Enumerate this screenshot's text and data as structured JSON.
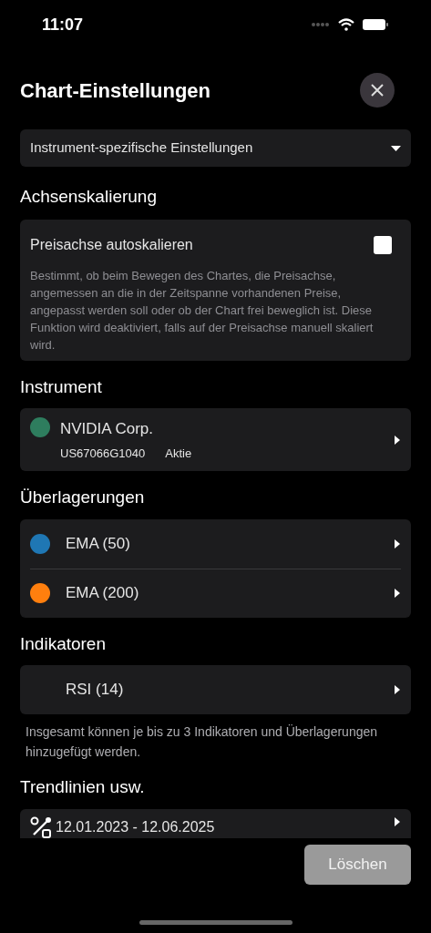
{
  "status_bar": {
    "time": "11:07"
  },
  "header": {
    "title": "Chart-Einstellungen"
  },
  "scope_dropdown": {
    "value": "Instrument-spezifische Einstellungen"
  },
  "axis_scaling": {
    "heading": "Achsenskalierung",
    "option": {
      "label": "Preisachse autoskalieren",
      "checked": false,
      "description": "Bestimmt, ob beim Bewegen des Chartes, die Preisachse, angemessen an die in der Zeitspanne vorhandenen Preise, angepasst werden soll oder ob der Chart frei beweglich ist. Diese Funktion wird deaktiviert, falls auf der Preisachse manuell skaliert wird."
    }
  },
  "instrument": {
    "heading": "Instrument",
    "name": "NVIDIA Corp.",
    "color": "#2e7d5e",
    "isin": "US67066G1040",
    "type": "Aktie"
  },
  "overlays": {
    "heading": "Überlagerungen",
    "items": [
      {
        "label": "EMA (50)",
        "color": "#1f77b4"
      },
      {
        "label": "EMA (200)",
        "color": "#ff7f0e"
      }
    ]
  },
  "indicators": {
    "heading": "Indikatoren",
    "items": [
      {
        "label": "RSI (14)"
      }
    ],
    "note": "Insgesamt können je bis zu 3 Indikatoren und Überlagerungen hinzugefügt werden."
  },
  "trendlines": {
    "heading": "Trendlinien usw.",
    "items": [
      {
        "label": "12.01.2023 - 12.06.2025"
      }
    ]
  },
  "footer": {
    "delete_button": {
      "label": "Löschen",
      "disabled": true
    }
  }
}
